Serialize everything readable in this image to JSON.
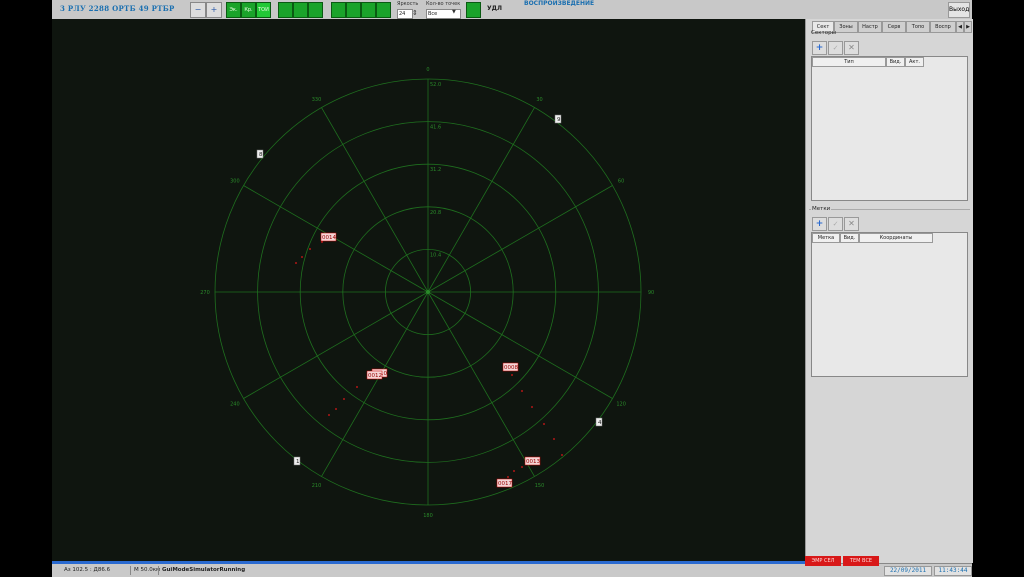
{
  "toolbar": {
    "title": "3 РЛУ 2288 ОРТБ 49 РТБР",
    "zoom_out_icon": "zoom-out-icon",
    "zoom_in_icon": "zoom-in-icon",
    "mode_buttons": [
      "Эк.",
      "Кр.",
      "ТОИ"
    ],
    "brightness_label": "Яркость",
    "brightness_value": "24",
    "points_label": "Кол-во точек",
    "points_value": "Все",
    "udl_label": "УДЛ",
    "playback_label": "ВОСПРОИЗВЕДЕНИЕ",
    "exit_label": "Выход"
  },
  "radar": {
    "range_labels": [
      "10.4",
      "20.8",
      "31.2",
      "41.6",
      "52.0"
    ],
    "bearing_labels": [
      "0",
      "30",
      "60",
      "90",
      "120",
      "150",
      "180",
      "210",
      "240",
      "270",
      "300",
      "330"
    ],
    "targets": [
      {
        "id": "0014"
      },
      {
        "id": "0010"
      },
      {
        "id": "0012"
      },
      {
        "id": "0008"
      },
      {
        "id": "0013"
      },
      {
        "id": "0017"
      }
    ],
    "markers": [
      "9",
      "8",
      "4",
      "1"
    ]
  },
  "panel": {
    "tabs": [
      "Сект",
      "Зоны",
      "Настр",
      "Серв",
      "Топо",
      "Воспр"
    ],
    "sectors_title": "Секторы",
    "sectors_columns": [
      "Тип",
      "Вид.",
      "Акт."
    ],
    "marks_title": "Метки",
    "marks_columns": [
      "Метка",
      "Вид.",
      "Координаты"
    ]
  },
  "status": {
    "azimuth": "Аз 102.5 : Д86.6",
    "scale": "М 50.0км",
    "mode": "GuiModeSimulatorRunning",
    "red_button_1": "ЭМР СЕЛ",
    "red_button_2": "ТЕМ ВСЕ",
    "date": "22/09/2011",
    "time": "11:43:44"
  },
  "colors": {
    "grid": "#1f7a1f",
    "track": "#e01818",
    "accent_green": "#1aa32a",
    "accent_blue": "#1a6fb0",
    "alert_red": "#d81818"
  }
}
